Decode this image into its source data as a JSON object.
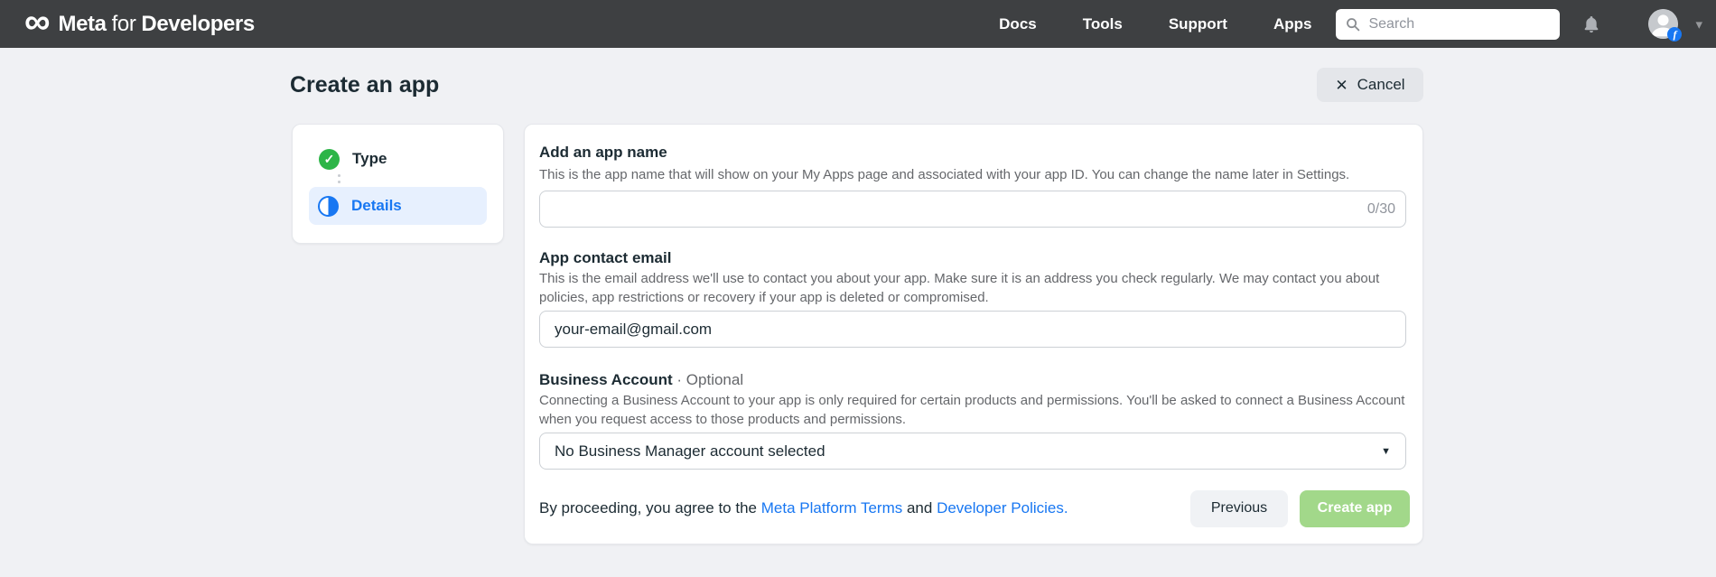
{
  "navbar": {
    "logo": {
      "meta": "Meta",
      "for": "for",
      "developers": "Developers"
    },
    "links": [
      {
        "label": "Docs"
      },
      {
        "label": "Tools"
      },
      {
        "label": "Support"
      },
      {
        "label": "Apps"
      }
    ],
    "search": {
      "placeholder": "Search"
    },
    "icons": {
      "logo_icon": "meta-infinity",
      "search_icon": "magnifier",
      "bell_icon": "notifications-bell",
      "avatar": "user-avatar-with-facebook-badge",
      "facebook_badge_letter": "f",
      "chevron": "account-menu-chevron-down"
    }
  },
  "header": {
    "title": "Create an app",
    "cancel_label": "Cancel",
    "cancel_icon": "✕"
  },
  "steps": [
    {
      "label": "Type",
      "state": "complete",
      "icon": "green-check-circle"
    },
    {
      "label": "Details",
      "state": "current",
      "icon": "half-filled-circle"
    }
  ],
  "form": {
    "app_name": {
      "label": "Add an app name",
      "description": "This is the app name that will show on your My Apps page and associated with your app ID. You can change the name later in Settings.",
      "value": "",
      "counter": "0/30"
    },
    "contact_email": {
      "label": "App contact email",
      "description": "This is the email address we'll use to contact you about your app. Make sure it is an address you check regularly. We may contact you about policies, app restrictions or recovery if your app is deleted or compromised.",
      "value": "your-email@gmail.com"
    },
    "business_account": {
      "label": "Business Account",
      "optional_label": " · Optional",
      "description": "Connecting a Business Account to your app is only required for certain products and permissions. You'll be asked to connect a Business Account when you request access to those products and permissions.",
      "selected_value": "No Business Manager account selected",
      "caret_icon": "▼"
    },
    "footer": {
      "agreement_prefix": "By proceeding, you agree to the ",
      "terms_link": "Meta Platform Terms",
      "and_text": " and ",
      "policies_link": "Developer Policies",
      "suffix": ".",
      "previous_label": "Previous",
      "create_label": "Create app"
    }
  },
  "colors": {
    "navbar_bg": "#3e4042",
    "page_bg": "#f0f1f4",
    "accent_blue": "#1877f2",
    "success_green": "#2db548",
    "disabled_create_green": "#a2d88a",
    "step_highlight": "#e7f0fe",
    "muted_text": "#65676b",
    "input_border": "#ccd0d5"
  }
}
